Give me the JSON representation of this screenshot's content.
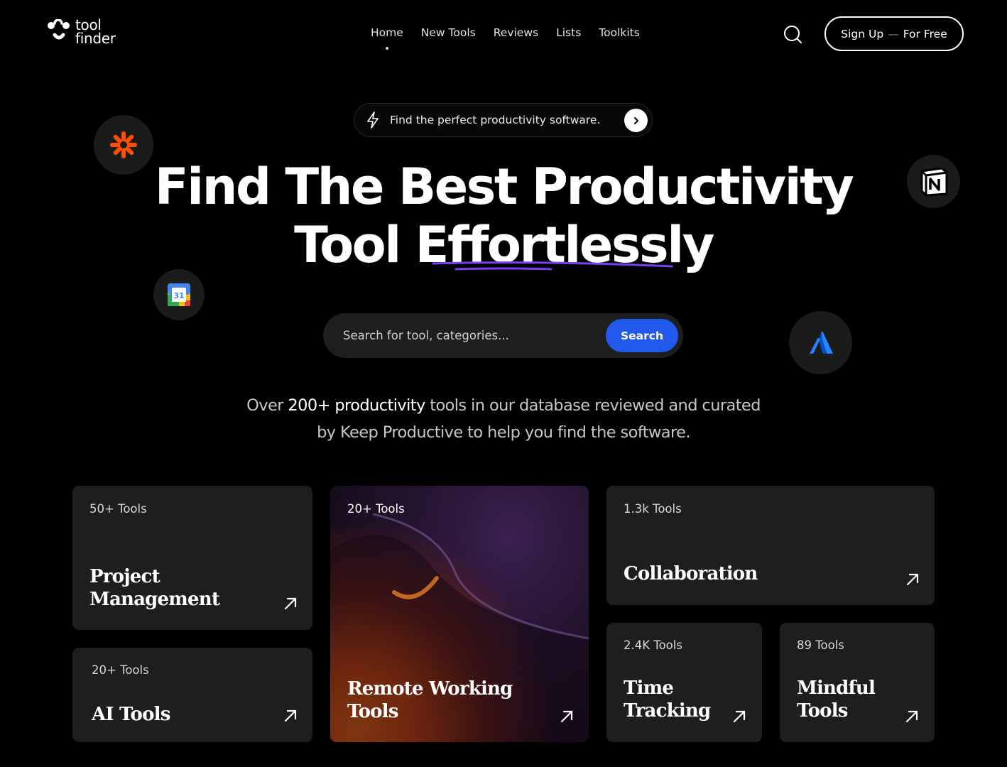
{
  "brand": {
    "line1": "tool",
    "line2": "finder"
  },
  "nav": {
    "items": [
      {
        "label": "Home",
        "active": true
      },
      {
        "label": "New Tools"
      },
      {
        "label": "Reviews"
      },
      {
        "label": "Lists"
      },
      {
        "label": "Toolkits"
      }
    ]
  },
  "header": {
    "signup_label": "Sign Up",
    "signup_dash": "—",
    "signup_suffix": "For Free"
  },
  "pill": {
    "text": "Find the perfect productivity software."
  },
  "hero": {
    "line1": "Find The Best Productivity",
    "line2": "Tool Effortlessly"
  },
  "search": {
    "placeholder": "Search for tool, categories...",
    "button_label": "Search"
  },
  "description": {
    "pre": "Over ",
    "highlight": "200+ productivity",
    "post": " tools in our database reviewed and curated",
    "line2": "by Keep Productive to help you find the software."
  },
  "floating_apps": [
    "zapier-icon",
    "google-calendar-icon",
    "notion-icon",
    "atlassian-icon"
  ],
  "colors": {
    "accent": "#2259ea",
    "underline": "#7b3ff2",
    "zapier": "#ff4f00"
  },
  "cards": [
    {
      "count": "50+ Tools",
      "title": "Project Management"
    },
    {
      "count": "20+ Tools",
      "title": "AI Tools"
    },
    {
      "count": "20+ Tools",
      "title": "Remote Working Tools"
    },
    {
      "count": "1.3k  Tools",
      "title": "Collaboration"
    },
    {
      "count": "2.4K Tools",
      "title": "Time Tracking"
    },
    {
      "count": "89 Tools",
      "title": "Mindful Tools"
    }
  ]
}
